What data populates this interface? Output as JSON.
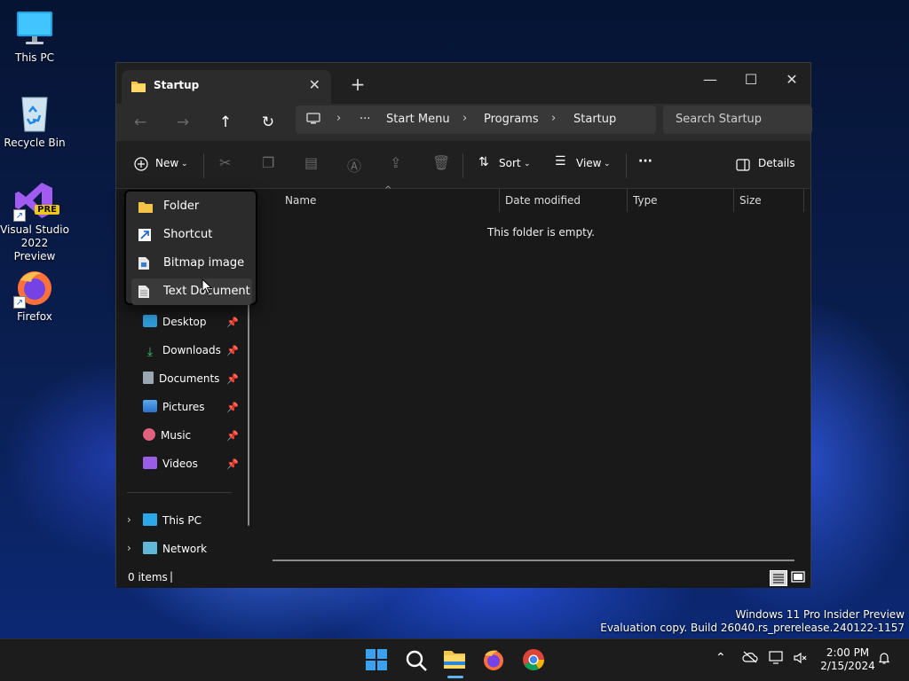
{
  "desktop": {
    "icons": [
      {
        "label": "This PC"
      },
      {
        "label": "Recycle Bin"
      },
      {
        "label": "Visual Studio 2022 Preview",
        "badge": "PRE"
      },
      {
        "label": "Firefox"
      }
    ]
  },
  "window": {
    "tab_title": "Startup",
    "new_tab": "+",
    "controls": {
      "minimize": "—",
      "maximize": "☐",
      "close": "✕"
    },
    "nav": {
      "back": "←",
      "forward": "→",
      "up": "↑",
      "refresh": "↻"
    },
    "breadcrumb": [
      "Start Menu",
      "Programs",
      "Startup"
    ],
    "breadcrumb_more": "···",
    "search_placeholder": "Search Startup"
  },
  "toolbar": {
    "new_label": "New",
    "sort_label": "Sort",
    "view_label": "View",
    "more": "···",
    "details_label": "Details"
  },
  "new_menu": {
    "items": [
      {
        "label": "Folder"
      },
      {
        "label": "Shortcut"
      },
      {
        "label": "Bitmap image"
      },
      {
        "label": "Text Document"
      }
    ]
  },
  "navpane": {
    "quick_access": [
      {
        "label": "Desktop"
      },
      {
        "label": "Downloads"
      },
      {
        "label": "Documents"
      },
      {
        "label": "Pictures"
      },
      {
        "label": "Music"
      },
      {
        "label": "Videos"
      }
    ],
    "roots": [
      {
        "label": "This PC"
      },
      {
        "label": "Network"
      }
    ]
  },
  "content": {
    "columns": [
      "Name",
      "Date modified",
      "Type",
      "Size"
    ],
    "empty_message": "This folder is empty."
  },
  "status": {
    "items_count": "0 items",
    "separator": "|"
  },
  "watermark": {
    "line1": "Windows 11 Pro Insider Preview",
    "line2": "Evaluation copy. Build 26040.rs_prerelease.240122-1157"
  },
  "taskbar": {
    "time": "2:00 PM",
    "date": "2/15/2024"
  },
  "colors": {
    "accent": "#0078d4",
    "folder_yellow": "#f3c34a"
  }
}
